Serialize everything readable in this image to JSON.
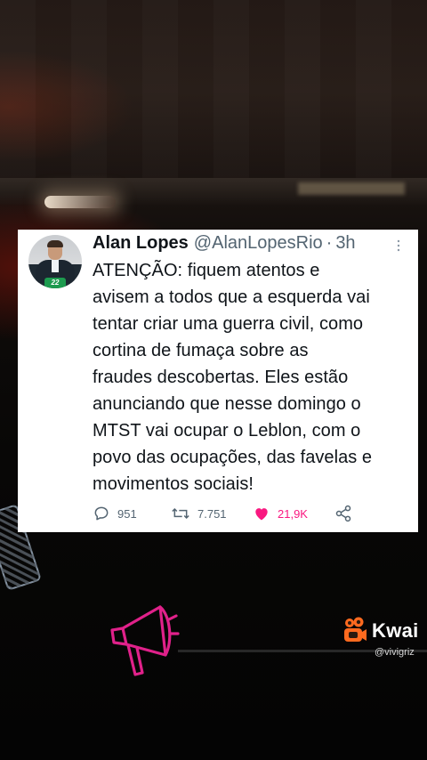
{
  "tweet": {
    "author_name": "Alan Lopes",
    "handle": "@AlanLopesRio",
    "separator": "·",
    "time": "3h",
    "avatar_badge": "22",
    "text": "ATENÇÃO: fiquem atentos e\navisem a todos que a esquerda vai\ntentar criar uma guerra civil, como\ncortina de fumaça sobre as\nfraudes descobertas. Eles estão\nanunciando que nesse domingo o\nMTST vai ocupar o Leblon, com o\npovo das ocupações, das favelas e\nmovimentos sociais!",
    "replies": "951",
    "retweets": "7.751",
    "likes": "21,9K",
    "icons": {
      "more": "more-options-icon",
      "reply": "reply-icon",
      "retweet": "retweet-icon",
      "like": "heart-icon",
      "share": "share-icon"
    }
  },
  "overlay": {
    "watermark_brand": "Kwai",
    "watermark_user": "@vivigriz",
    "sticker": "megaphone-icon"
  },
  "colors": {
    "like_pink": "#f91880",
    "muted_gray": "#536471",
    "text_dark": "#0f1419",
    "kwai_orange": "#ff6a1f",
    "megaphone_magenta": "#e0218a"
  }
}
